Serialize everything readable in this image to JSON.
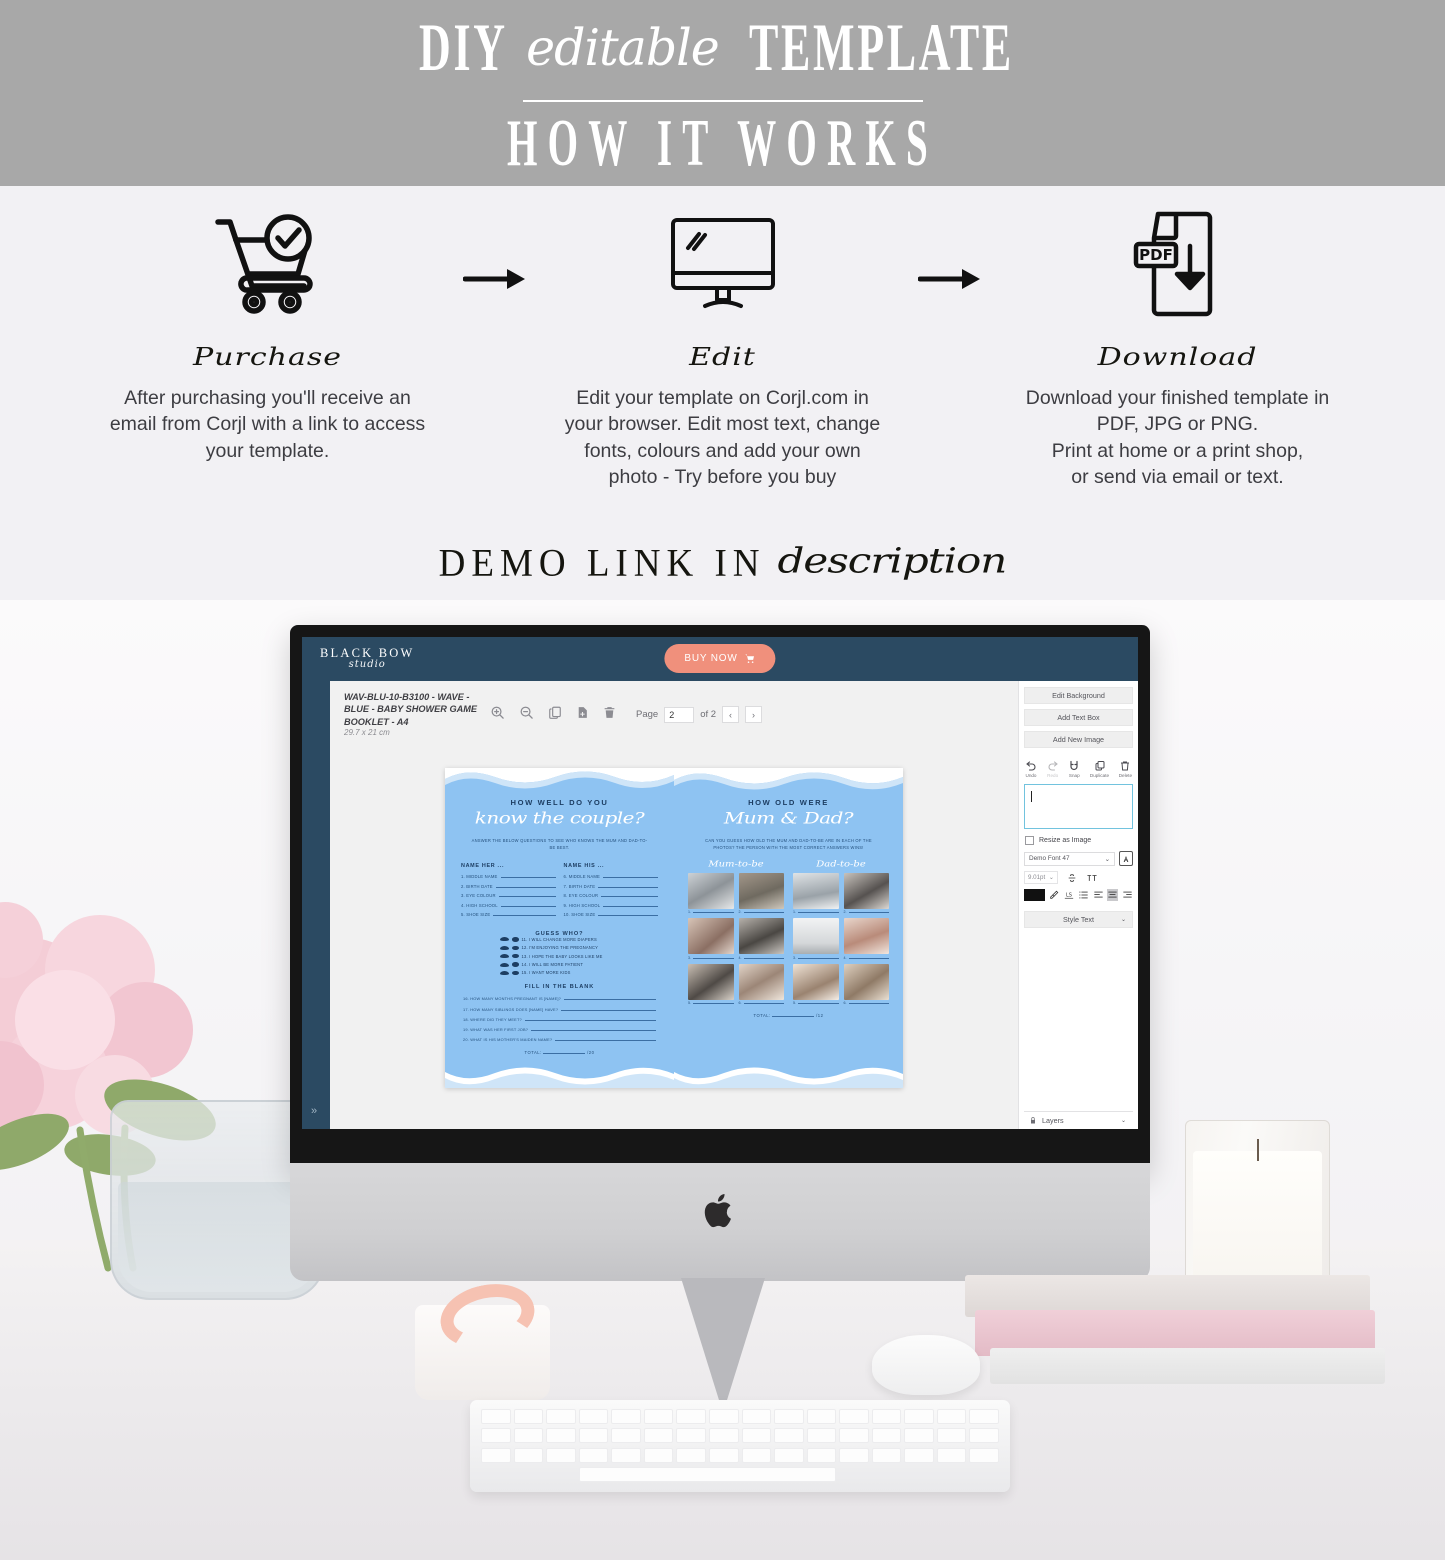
{
  "banner": {
    "line1_part1": "DIY",
    "line1_script": "editable",
    "line1_part2": "TEMPLATE",
    "line2": "HOW IT WORKS"
  },
  "steps": [
    {
      "icon": "shopping-cart-check-icon",
      "title": "Purchase",
      "body": "After purchasing you'll receive an email from Corjl with a link to access your template."
    },
    {
      "icon": "desktop-monitor-edit-icon",
      "title": "Edit",
      "body": "Edit your template on Corjl.com in your browser. Edit most text, change fonts, colours and add your own photo - Try before you buy"
    },
    {
      "icon": "pdf-download-icon",
      "title": "Download",
      "body": "Download your finished template in PDF, JPG or PNG.\nPrint at home or a print shop,\nor send via email or text."
    }
  ],
  "arrow_glyph": "→",
  "demo_link": {
    "part1": "DEMO LINK IN",
    "script": "description"
  },
  "editor": {
    "brand": {
      "line1": "BLACK BOW",
      "line2": "studio"
    },
    "buy_now": "BUY NOW",
    "buy_now_color": "#f0907c",
    "topbar_color": "#2b4a62",
    "document": {
      "title": "WAV-BLU-10-B3100 - WAVE - BLUE - BABY SHOWER GAME BOOKLET - A4",
      "dimensions": "29.7 x 21 cm"
    },
    "toolbar_icons": [
      "zoom-in-icon",
      "zoom-out-icon",
      "duplicate-page-icon",
      "add-page-icon",
      "delete-page-icon"
    ],
    "page_nav": {
      "label": "Page",
      "value": "2",
      "of": "of 2",
      "prev": "‹",
      "next": "›"
    },
    "sidebar": {
      "buttons": [
        "Edit Background",
        "Add Text Box",
        "Add New Image"
      ],
      "tools": [
        {
          "label": "Undo",
          "icon": "undo-icon",
          "disabled": false
        },
        {
          "label": "Redo",
          "icon": "redo-icon",
          "disabled": true
        },
        {
          "label": "Snap",
          "icon": "snap-magnet-icon",
          "disabled": false
        },
        {
          "label": "Duplicate",
          "icon": "duplicate-icon",
          "disabled": false
        },
        {
          "label": "Delete",
          "icon": "trash-icon",
          "disabled": false
        }
      ],
      "text_value": "",
      "resize_as_image": "Resize as Image",
      "font_name": "Demo Font 47",
      "font_size": "9.01pt",
      "style_text": "Style Text",
      "layers": "Layers",
      "text_color": "#111111"
    }
  },
  "template_left": {
    "title_small": "HOW WELL DO YOU",
    "title_script": "know the couple?",
    "subtitle": "ANSWER THE BELOW QUESTIONS TO SEE WHO KNOWS THE MUM AND DAD-TO-BE BEST.",
    "col_her_header": "NAME HER ...",
    "col_his_header": "NAME HIS ...",
    "col_her": [
      "1. MIDDLE NAME",
      "2. BIRTH DATE",
      "3. EYE COLOUR",
      "4. HIGH SCHOOL",
      "5. SHOE SIZE"
    ],
    "col_his": [
      "6. MIDDLE NAME",
      "7. BIRTH DATE",
      "8. EYE COLOUR",
      "9. HIGH SCHOOL",
      "10. SHOE SIZE"
    ],
    "guess_who_header": "GUESS WHO?",
    "guess_who": [
      "11. I WILL CHANGE MORE DIAPERS",
      "12. I'M ENJOYING THE PREGNANCY",
      "13. I HOPE THE BABY LOOKS LIKE ME",
      "14. I WILL BE MORE PATIENT",
      "15. I WANT MORE KIDS"
    ],
    "fill_blank_header": "FILL IN THE BLANK",
    "fill_blank": [
      "16. HOW MANY MONTHS PREGNANT IS [NAME]?",
      "17. HOW MANY SIBLINGS DOES [NAME] HAVE?",
      "18. WHERE DID THEY MEET?",
      "19. WHAT WAS HER FIRST JOB?",
      "20. WHAT IS HIS MOTHER'S MAIDEN NAME?"
    ],
    "total_label": "TOTAL:",
    "total_suffix": "/20"
  },
  "template_right": {
    "title_small": "HOW OLD WERE",
    "title_script": "Mum & Dad?",
    "subtitle": "CAN YOU GUESS HOW OLD THE MUM AND DAD-TO-BE ARE IN EACH OF THE PHOTOS? THE PERSON WITH THE MOST CORRECT ANSWERS WINS!",
    "col_mum_header": "Mum-to-be",
    "col_dad_header": "Dad-to-be",
    "photo_numbers": [
      "1.",
      "2.",
      "3.",
      "4.",
      "5.",
      "6."
    ],
    "total_label": "TOTAL:",
    "total_suffix": "/12"
  },
  "colors": {
    "banner_gray": "#a8a8a8",
    "page_bg": "#f2f1f4",
    "template_blue": "#8ec3f2",
    "template_navy": "#1d3e63"
  }
}
